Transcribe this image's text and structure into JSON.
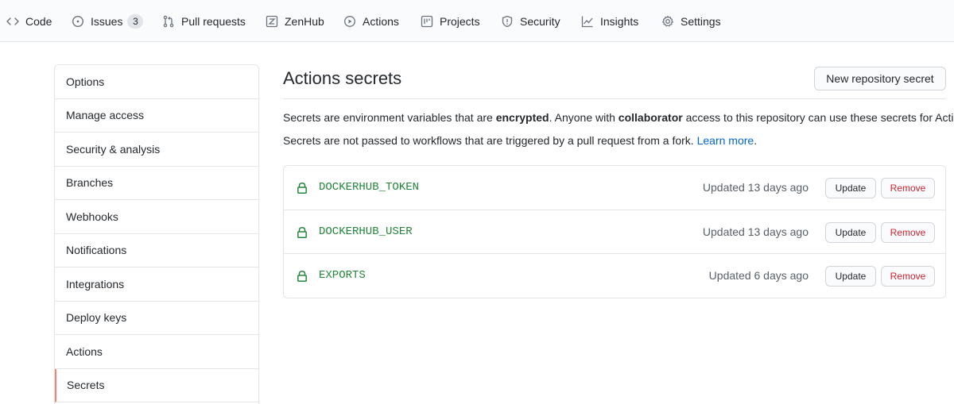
{
  "nav": {
    "tabs": [
      {
        "label": "Code",
        "icon": "code-icon"
      },
      {
        "label": "Issues",
        "icon": "issue-icon",
        "count": "3"
      },
      {
        "label": "Pull requests",
        "icon": "pull-request-icon"
      },
      {
        "label": "ZenHub",
        "icon": "zenhub-icon"
      },
      {
        "label": "Actions",
        "icon": "play-icon"
      },
      {
        "label": "Projects",
        "icon": "project-icon"
      },
      {
        "label": "Security",
        "icon": "shield-icon"
      },
      {
        "label": "Insights",
        "icon": "graph-icon"
      },
      {
        "label": "Settings",
        "icon": "gear-icon"
      }
    ]
  },
  "sidebar": {
    "items": [
      {
        "label": "Options"
      },
      {
        "label": "Manage access"
      },
      {
        "label": "Security & analysis"
      },
      {
        "label": "Branches"
      },
      {
        "label": "Webhooks"
      },
      {
        "label": "Notifications"
      },
      {
        "label": "Integrations"
      },
      {
        "label": "Deploy keys"
      },
      {
        "label": "Actions"
      },
      {
        "label": "Secrets",
        "selected": true
      }
    ],
    "selected_color": "#f9826c"
  },
  "main": {
    "title": "Actions secrets",
    "new_button": "New repository secret",
    "para1": {
      "t1": "Secrets are environment variables that are ",
      "b1": "encrypted",
      "t2": ". Anyone with ",
      "b2": "collaborator",
      "t3": " access to this repository can use these secrets for Actions."
    },
    "para2": {
      "t1": "Secrets are not passed to workflows that are triggered by a pull request from a fork. ",
      "link": "Learn more",
      "t2": "."
    },
    "secrets": [
      {
        "name": "DOCKERHUB_TOKEN",
        "updated": "Updated 13 days ago",
        "update_label": "Update",
        "remove_label": "Remove"
      },
      {
        "name": "DOCKERHUB_USER",
        "updated": "Updated 13 days ago",
        "update_label": "Update",
        "remove_label": "Remove"
      },
      {
        "name": "EXPORTS",
        "updated": "Updated 6 days ago",
        "update_label": "Update",
        "remove_label": "Remove"
      }
    ]
  },
  "colors": {
    "secret_name": "#22863a",
    "link": "#0366d6",
    "danger": "#cb2431"
  }
}
